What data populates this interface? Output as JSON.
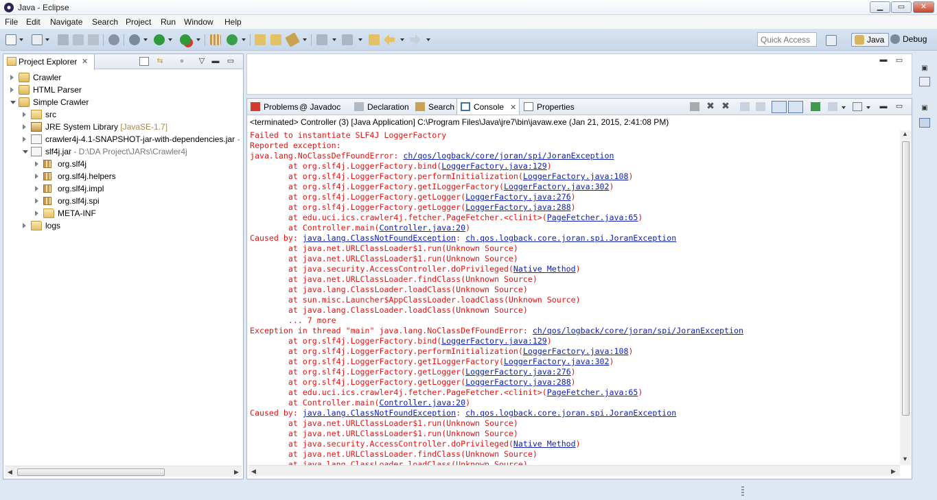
{
  "window": {
    "title": "Java - Eclipse",
    "controls": {
      "minimize": "▁",
      "maximize": "▭",
      "close": "✕"
    }
  },
  "menubar": [
    "File",
    "Edit",
    "Navigate",
    "Search",
    "Project",
    "Run",
    "Window",
    "Help"
  ],
  "toolbar": {
    "quick_access_placeholder": "Quick Access",
    "perspectives": [
      {
        "label": "Java",
        "active": true
      },
      {
        "label": "Debug",
        "active": false
      }
    ]
  },
  "project_explorer": {
    "tab_label": "Project Explorer",
    "tree": [
      {
        "label": "Crawler",
        "suffix": "",
        "icon": "project",
        "depth": 0,
        "twisty": "closed"
      },
      {
        "label": "HTML Parser",
        "suffix": "",
        "icon": "project",
        "depth": 0,
        "twisty": "closed"
      },
      {
        "label": "Simple Crawler",
        "suffix": "",
        "icon": "project",
        "depth": 0,
        "twisty": "open"
      },
      {
        "label": "src",
        "suffix": "",
        "icon": "srcfolder",
        "depth": 1,
        "twisty": "closed"
      },
      {
        "label": "JRE System Library",
        "suffix": " [JavaSE-1.7]",
        "icon": "lib",
        "depth": 1,
        "twisty": "closed"
      },
      {
        "label": "crawler4j-4.1-SNAPSHOT-jar-with-dependencies.jar",
        "suffix": " -",
        "icon": "jar",
        "depth": 1,
        "twisty": "closed"
      },
      {
        "label": "slf4j.jar",
        "suffix": " - D:\\DA Project\\JARs\\Crawler4j",
        "icon": "jar",
        "depth": 1,
        "twisty": "open"
      },
      {
        "label": "org.slf4j",
        "suffix": "",
        "icon": "pkg",
        "depth": 2,
        "twisty": "closed"
      },
      {
        "label": "org.slf4j.helpers",
        "suffix": "",
        "icon": "pkg",
        "depth": 2,
        "twisty": "closed"
      },
      {
        "label": "org.slf4j.impl",
        "suffix": "",
        "icon": "pkg",
        "depth": 2,
        "twisty": "closed"
      },
      {
        "label": "org.slf4j.spi",
        "suffix": "",
        "icon": "pkg",
        "depth": 2,
        "twisty": "closed"
      },
      {
        "label": "META-INF",
        "suffix": "",
        "icon": "folder",
        "depth": 2,
        "twisty": "closed"
      },
      {
        "label": "logs",
        "suffix": "",
        "icon": "folder",
        "depth": 1,
        "twisty": "closed"
      }
    ]
  },
  "console_view": {
    "tabs": [
      {
        "label": "Problems",
        "active": false
      },
      {
        "label": "@ Javadoc",
        "active": false
      },
      {
        "label": "Declaration",
        "active": false
      },
      {
        "label": "Search",
        "active": false
      },
      {
        "label": "Console",
        "active": true
      },
      {
        "label": "Properties",
        "active": false
      }
    ],
    "header": "<terminated> Controller (3) [Java Application] C:\\Program Files\\Java\\jre7\\bin\\javaw.exe (Jan 21, 2015, 2:41:08 PM)",
    "lines": [
      {
        "text": "Failed to instantiate SLF4J LoggerFactory",
        "link": ""
      },
      {
        "text": "Reported exception:",
        "link": ""
      },
      {
        "text": "java.lang.NoClassDefFoundError: ",
        "link": "ch/qos/logback/core/joran/spi/JoranException"
      },
      {
        "text": "        at org.slf4j.LoggerFactory.bind(",
        "link": "LoggerFactory.java:129",
        "end": ")"
      },
      {
        "text": "        at org.slf4j.LoggerFactory.performInitialization(",
        "link": "LoggerFactory.java:108",
        "end": ")"
      },
      {
        "text": "        at org.slf4j.LoggerFactory.getILoggerFactory(",
        "link": "LoggerFactory.java:302",
        "end": ")"
      },
      {
        "text": "        at org.slf4j.LoggerFactory.getLogger(",
        "link": "LoggerFactory.java:276",
        "end": ")"
      },
      {
        "text": "        at org.slf4j.LoggerFactory.getLogger(",
        "link": "LoggerFactory.java:288",
        "end": ")"
      },
      {
        "text": "        at edu.uci.ics.crawler4j.fetcher.PageFetcher.<clinit>(",
        "link": "PageFetcher.java:65",
        "end": ")"
      },
      {
        "text": "        at Controller.main(",
        "link": "Controller.java:20",
        "end": ")"
      },
      {
        "text": "Caused by: ",
        "link": "java.lang.ClassNotFoundException",
        "end": ": ",
        "link2": "ch.qos.logback.core.joran.spi.JoranException"
      },
      {
        "text": "        at java.net.URLClassLoader$1.run(Unknown Source)",
        "link": ""
      },
      {
        "text": "        at java.net.URLClassLoader$1.run(Unknown Source)",
        "link": ""
      },
      {
        "text": "        at java.security.AccessController.doPrivileged(",
        "link": "Native Method",
        "end": ")"
      },
      {
        "text": "        at java.net.URLClassLoader.findClass(Unknown Source)",
        "link": ""
      },
      {
        "text": "        at java.lang.ClassLoader.loadClass(Unknown Source)",
        "link": ""
      },
      {
        "text": "        at sun.misc.Launcher$AppClassLoader.loadClass(Unknown Source)",
        "link": ""
      },
      {
        "text": "        at java.lang.ClassLoader.loadClass(Unknown Source)",
        "link": ""
      },
      {
        "text": "        ... 7 more",
        "link": ""
      },
      {
        "text": "Exception in thread \"main\" java.lang.NoClassDefFoundError: ",
        "link": "ch/qos/logback/core/joran/spi/JoranException"
      },
      {
        "text": "        at org.slf4j.LoggerFactory.bind(",
        "link": "LoggerFactory.java:129",
        "end": ")"
      },
      {
        "text": "        at org.slf4j.LoggerFactory.performInitialization(",
        "link": "LoggerFactory.java:108",
        "end": ")"
      },
      {
        "text": "        at org.slf4j.LoggerFactory.getILoggerFactory(",
        "link": "LoggerFactory.java:302",
        "end": ")"
      },
      {
        "text": "        at org.slf4j.LoggerFactory.getLogger(",
        "link": "LoggerFactory.java:276",
        "end": ")"
      },
      {
        "text": "        at org.slf4j.LoggerFactory.getLogger(",
        "link": "LoggerFactory.java:288",
        "end": ")"
      },
      {
        "text": "        at edu.uci.ics.crawler4j.fetcher.PageFetcher.<clinit>(",
        "link": "PageFetcher.java:65",
        "end": ")"
      },
      {
        "text": "        at Controller.main(",
        "link": "Controller.java:20",
        "end": ")"
      },
      {
        "text": "Caused by: ",
        "link": "java.lang.ClassNotFoundException",
        "end": ": ",
        "link2": "ch.qos.logback.core.joran.spi.JoranException"
      },
      {
        "text": "        at java.net.URLClassLoader$1.run(Unknown Source)",
        "link": ""
      },
      {
        "text": "        at java.net.URLClassLoader$1.run(Unknown Source)",
        "link": ""
      },
      {
        "text": "        at java.security.AccessController.doPrivileged(",
        "link": "Native Method",
        "end": ")"
      },
      {
        "text": "        at java.net.URLClassLoader.findClass(Unknown Source)",
        "link": ""
      },
      {
        "text": "        at java.lang.ClassLoader.loadClass(Unknown Source)",
        "link": ""
      }
    ]
  },
  "colors": {
    "error_text": "#e81111",
    "link_text": "#1020b4",
    "toolbar_bg": "#c7d7ea",
    "window_bg": "#dfe8f2"
  }
}
